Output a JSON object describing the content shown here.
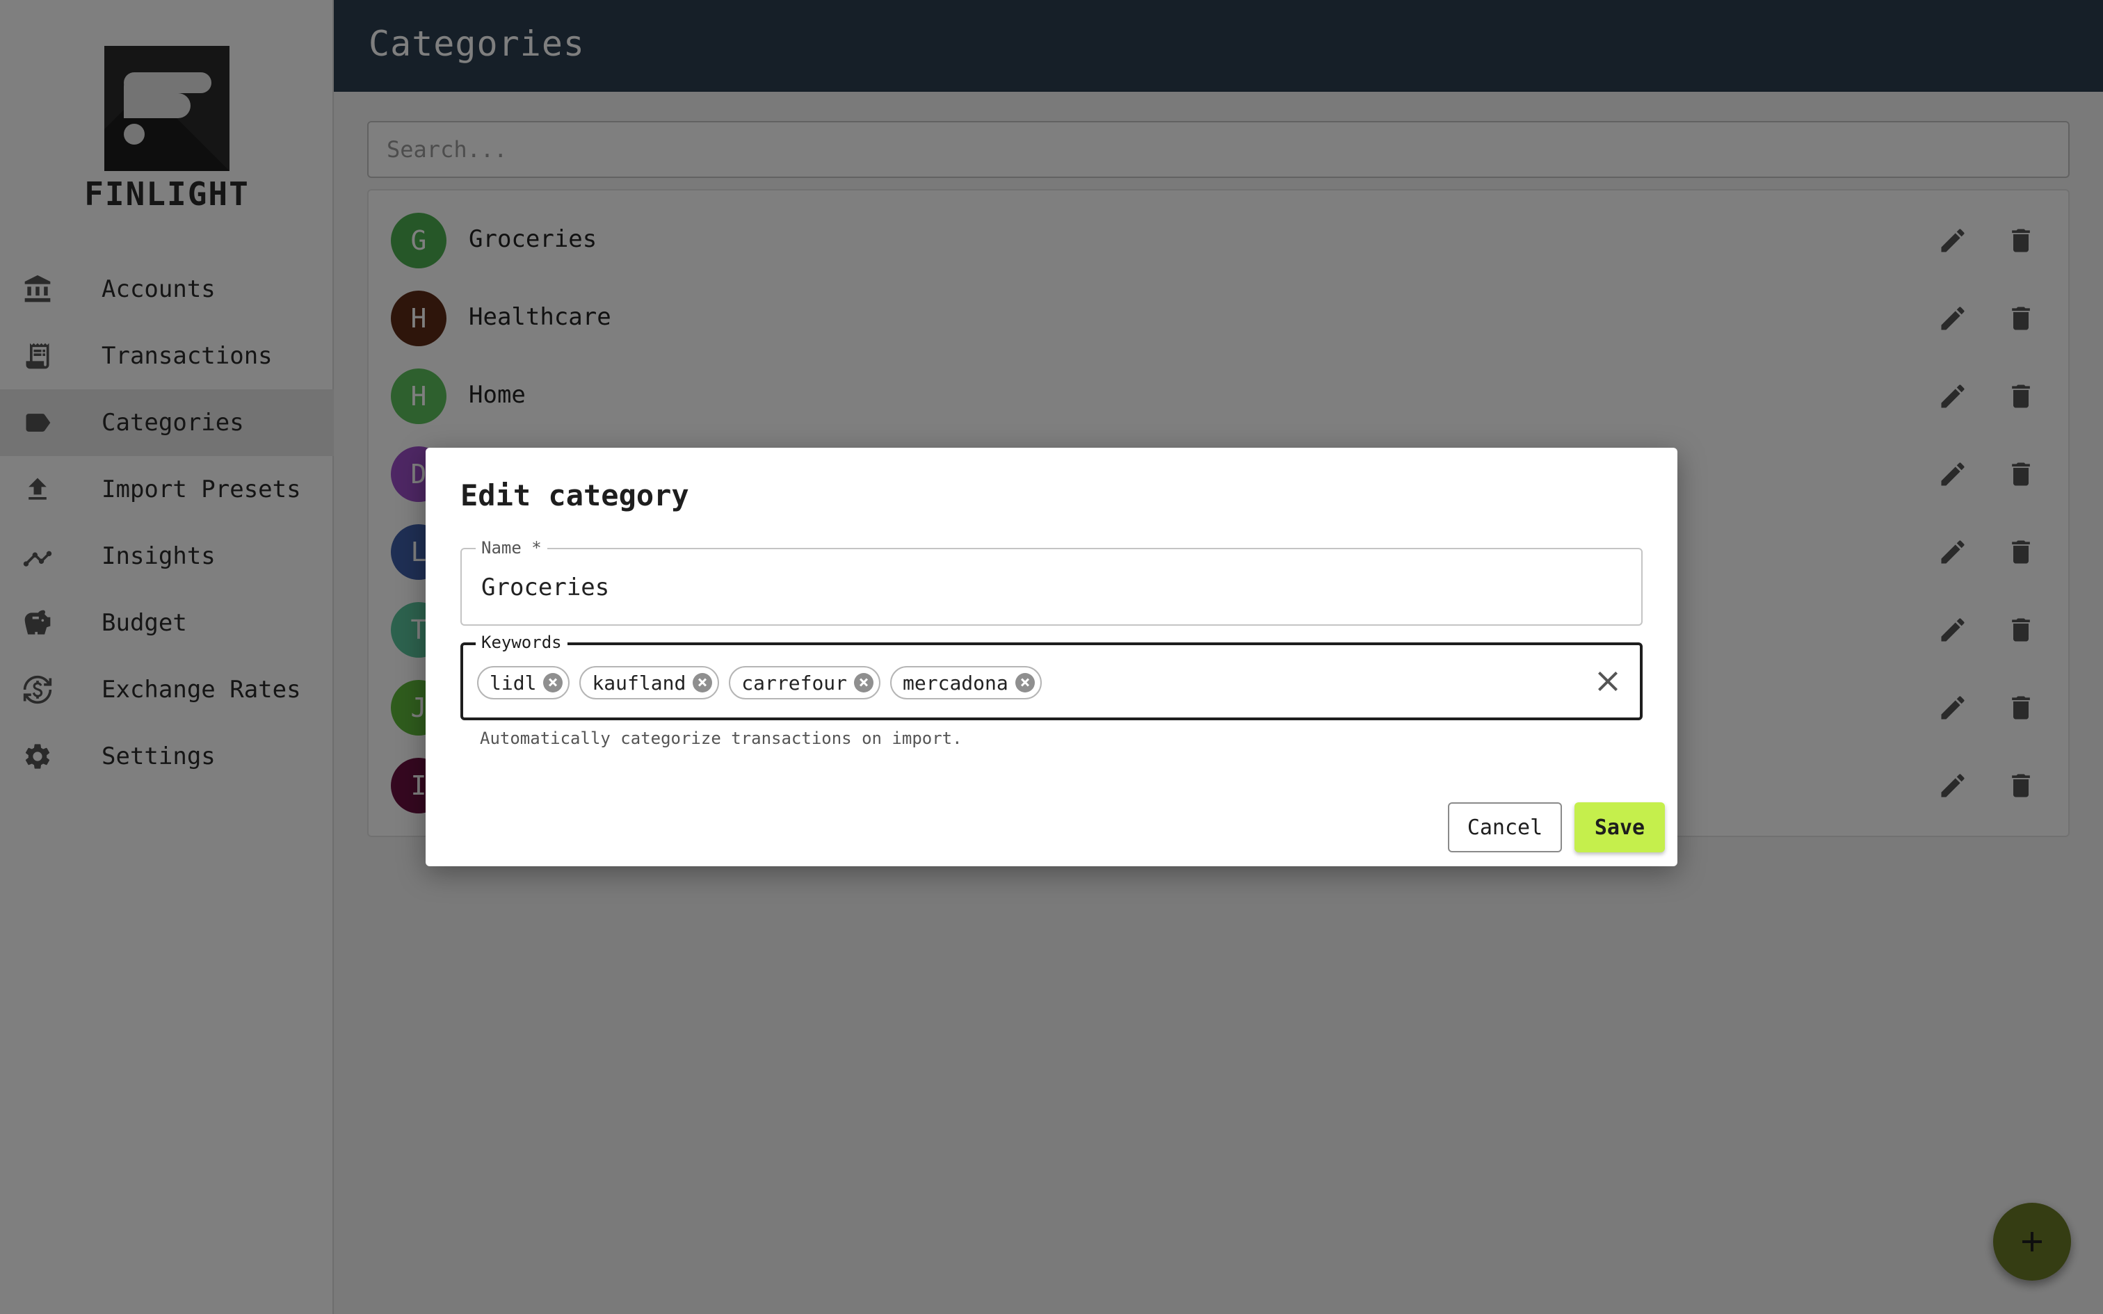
{
  "app": {
    "logo_text": "FINLIGHT",
    "page_title": "Categories"
  },
  "sidebar": {
    "items": [
      {
        "label": "Accounts",
        "icon": "bank-icon",
        "active": false
      },
      {
        "label": "Transactions",
        "icon": "receipt-icon",
        "active": false
      },
      {
        "label": "Categories",
        "icon": "label-icon",
        "active": true
      },
      {
        "label": "Import Presets",
        "icon": "upload-icon",
        "active": false
      },
      {
        "label": "Insights",
        "icon": "insights-icon",
        "active": false
      },
      {
        "label": "Budget",
        "icon": "piggy-bank-icon",
        "active": false
      },
      {
        "label": "Exchange Rates",
        "icon": "currency-exchange-icon",
        "active": false
      },
      {
        "label": "Settings",
        "icon": "gear-icon",
        "active": false
      }
    ]
  },
  "search": {
    "placeholder": "Search..."
  },
  "categories": [
    {
      "initial": "G",
      "label": "Groceries",
      "color": "#4caf50"
    },
    {
      "initial": "H",
      "label": "Healthcare",
      "color": "#5d2a17"
    },
    {
      "initial": "H",
      "label": "Home",
      "color": "#5cc15c"
    },
    {
      "initial": "D",
      "label": "",
      "color": "#9c4fc9"
    },
    {
      "initial": "L",
      "label": "",
      "color": "#3f5ea8"
    },
    {
      "initial": "T",
      "label": "",
      "color": "#5bc59c"
    },
    {
      "initial": "J",
      "label": "",
      "color": "#5fb83a"
    },
    {
      "initial": "I",
      "label": "",
      "color": "#6b1140"
    }
  ],
  "dialog": {
    "title": "Edit category",
    "name_label": "Name *",
    "name_value": "Groceries",
    "keywords_label": "Keywords",
    "keywords": [
      "lidl",
      "kaufland",
      "carrefour",
      "mercadona"
    ],
    "helper_text": "Automatically categorize transactions on import.",
    "cancel_label": "Cancel",
    "save_label": "Save"
  },
  "colors": {
    "header_bg": "#2c3e50",
    "accent": "#c5ef4c",
    "fab": "#6b7a26"
  }
}
